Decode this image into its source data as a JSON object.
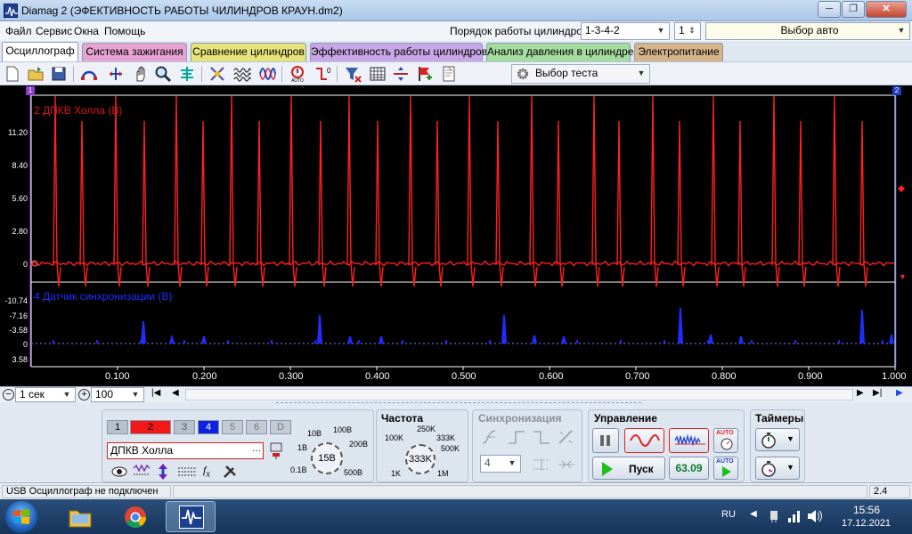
{
  "window": {
    "title": "Diamag 2 (ЭФЕКТИВНОСТЬ РАБОТЫ ЧИЛИНДРОВ КРАУН.dm2)",
    "minimize": "─",
    "maximize": "❐",
    "close": "✕"
  },
  "menu": {
    "items": [
      "Файл",
      "Сервис",
      "Окна",
      "Помощь"
    ]
  },
  "cylinder_order": {
    "label": "Порядок работы цилиндров",
    "value": "1-3-4-2",
    "first_cylinder": "1",
    "car_select": "Выбор авто"
  },
  "tabs": [
    {
      "label": "Осциллограф",
      "color": "#ffffff",
      "active": true
    },
    {
      "label": "Система зажигания",
      "color": "#e6a2d0"
    },
    {
      "label": "Сравнение цилиндров",
      "color": "#e7e27a"
    },
    {
      "label": "Эффективность работы цилиндров",
      "color": "#c8a6e6"
    },
    {
      "label": "Анализ давления в цилиндре",
      "color": "#a6dba0"
    },
    {
      "label": "Электропитание",
      "color": "#d6b48a"
    }
  ],
  "toolbar": {
    "icons": [
      "new-file-icon",
      "open-folder-icon",
      "save-icon",
      "arc-tool-icon",
      "scale-tool-icon",
      "hand-tool-icon",
      "zoom-icon",
      "cursor-measure-icon",
      "auto-fit-icon",
      "spectrum-icon",
      "lissajous-icon",
      "auto-scale-icon",
      "reset-zero-icon",
      "filter-icon",
      "grid-icon",
      "split-icon",
      "marker-flag-icon",
      "notes-icon"
    ],
    "test_select": "Выбор теста"
  },
  "scope": {
    "channel1": {
      "name": "2 ДПКВ Холла (В)",
      "color": "#ff2020",
      "y_ticks": [
        "11.20",
        "8.40",
        "5.60",
        "2.80",
        "0"
      ]
    },
    "channel2": {
      "name": "4 Датчик синхронизации (В)",
      "color": "#1f2dff",
      "y_ticks": [
        "-10.74",
        "-7.16",
        "-3.58",
        "0",
        "3.58"
      ]
    },
    "x_ticks": [
      "0.100",
      "0.200",
      "0.300",
      "0.400",
      "0.500",
      "0.600",
      "0.700",
      "0.800",
      "0.900",
      "1.000"
    ],
    "cursor_left": "1",
    "cursor_right": "2"
  },
  "timebar": {
    "period": "1 сек",
    "zoom": "100"
  },
  "channels_panel": {
    "buttons": [
      "1",
      "2",
      "3",
      "4",
      "5",
      "6",
      "D"
    ],
    "selected_signal": "ДПКВ Холла",
    "volt_dial": {
      "value": "15В",
      "labels": [
        "10В",
        "100В",
        "1В",
        "200В",
        "0.1В",
        "500В"
      ]
    }
  },
  "frequency_panel": {
    "title": "Частота",
    "value": "333K",
    "labels": [
      "250K",
      "100K",
      "333K",
      "500K",
      "1K",
      "1M"
    ]
  },
  "sync_panel": {
    "title": "Синхронизация",
    "value": "4"
  },
  "control_panel": {
    "title": "Управление",
    "start": "Пуск",
    "readout": "63.09",
    "auto1": "AUTO",
    "auto2": "AUTO"
  },
  "timers_panel": {
    "title": "Таймеры"
  },
  "status": {
    "message": "USB Осциллограф не подключен",
    "version": "2.4"
  },
  "taskbar": {
    "lang": "RU",
    "time": "15:56",
    "date": "17.12.2021"
  }
}
